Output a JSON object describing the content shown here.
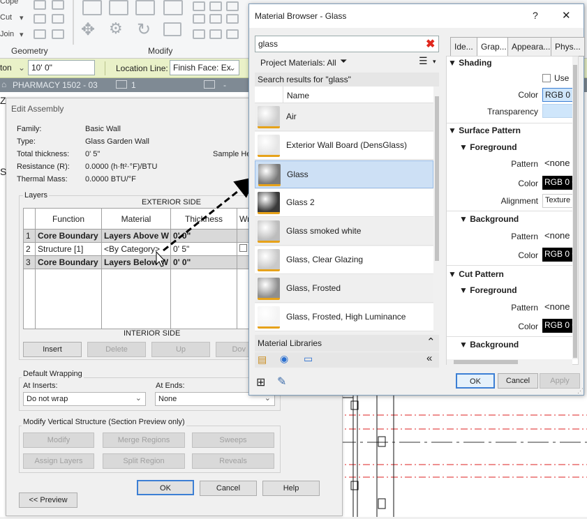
{
  "ribbon": {
    "small_items": [
      "Cope",
      "Cut",
      "Join"
    ],
    "panels": [
      "Geometry",
      "Modify"
    ]
  },
  "options_bar": {
    "left_value": "ton",
    "height_value": "10'  0\"",
    "location_line_label": "Location Line:",
    "location_line_value": "Finish Face: Ex"
  },
  "view_bar": {
    "title": "PHARMACY 1502 - 03",
    "num": "1",
    "dash": "-"
  },
  "edit_assembly": {
    "title": "Edit Assembly",
    "family_label": "Family:",
    "family_value": "Basic Wall",
    "type_label": "Type:",
    "type_value": "Glass Garden Wall",
    "thickness_label": "Total thickness:",
    "thickness_value": "0'  5\"",
    "resistance_label": "Resistance (R):",
    "resistance_value": "0.0000 (h·ft²·°F)/BTU",
    "mass_label": "Thermal Mass:",
    "mass_value": "0.0000 BTU/°F",
    "sample_height": "Sample He",
    "layers_label": "Layers",
    "exterior_side": "EXTERIOR SIDE",
    "interior_side": "INTERIOR SIDE",
    "columns": [
      "Function",
      "Material",
      "Thickness",
      "Wr"
    ],
    "rows": [
      {
        "n": "1",
        "function": "Core Boundary",
        "material": "Layers Above W",
        "thickness": "0'  0\""
      },
      {
        "n": "2",
        "function": "Structure [1]",
        "material": "<By Category>",
        "thickness": "0'  5\""
      },
      {
        "n": "3",
        "function": "Core Boundary",
        "material": "Layers Below W",
        "thickness": "0'  0\""
      }
    ],
    "buttons": {
      "insert": "Insert",
      "delete": "Delete",
      "up": "Up",
      "down": "Dov"
    },
    "default_wrapping": "Default Wrapping",
    "at_inserts_label": "At Inserts:",
    "at_inserts_value": "Do not wrap",
    "at_ends_label": "At Ends:",
    "at_ends_value": "None",
    "modify_vertical": "Modify Vertical Structure (Section Preview only)",
    "modify": "Modify",
    "merge_regions": "Merge Regions",
    "sweeps": "Sweeps",
    "assign_layers": "Assign Layers",
    "split_region": "Split Region",
    "reveals": "Reveals",
    "ok": "OK",
    "cancel": "Cancel",
    "help": "Help",
    "preview": "<< Preview"
  },
  "material_browser": {
    "title": "Material Browser - Glass",
    "help": "?",
    "close": "✕",
    "search_value": "glass",
    "project_materials": "Project Materials: All",
    "search_results": "Search results for \"glass\"",
    "name_header": "Name",
    "items": [
      {
        "name": "Air",
        "color": "#cfcfcf"
      },
      {
        "name": "Exterior Wall Board (DensGlass)",
        "color": "#e6e6e6"
      },
      {
        "name": "Glass",
        "color": "#7a7a7a"
      },
      {
        "name": "Glass 2",
        "color": "#3a3a3a"
      },
      {
        "name": "Glass smoked white",
        "color": "#bdbdbd"
      },
      {
        "name": "Glass, Clear Glazing",
        "color": "#c9c9c9"
      },
      {
        "name": "Glass, Frosted",
        "color": "#8f8f8f"
      },
      {
        "name": "Glass, Frosted, High Luminance",
        "color": "#f4f4f4"
      }
    ],
    "selected_index": 2,
    "material_libraries": "Material Libraries",
    "tabs": [
      "Ide...",
      "Grap...",
      "Appeara...",
      "Phys..."
    ],
    "active_tab": 1,
    "shading": "Shading",
    "use": "Use",
    "color_label": "Color",
    "color_value_light": "RGB 0 1",
    "transparency_label": "Transparency",
    "surface_pattern": "Surface Pattern",
    "foreground": "Foreground",
    "background": "Background",
    "cut_pattern": "Cut Pattern",
    "pattern_label": "Pattern",
    "pattern_value": "<none",
    "color_value_dark": "RGB 0 0",
    "alignment_label": "Alignment",
    "alignment_value": "Texture",
    "ok": "OK",
    "cancel": "Cancel",
    "apply": "Apply"
  }
}
